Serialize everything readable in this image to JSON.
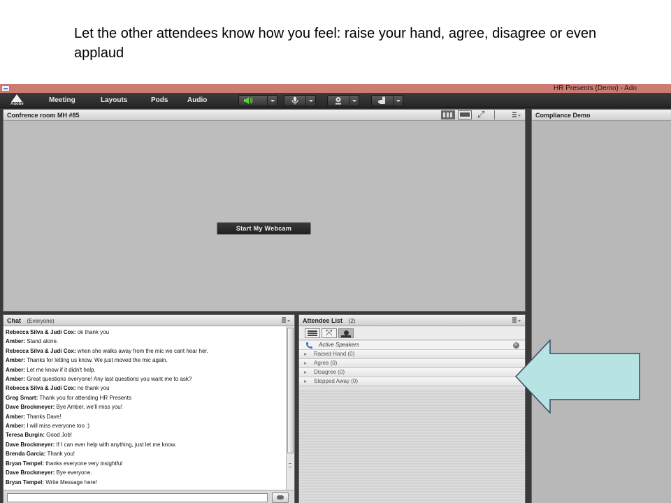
{
  "slide": {
    "caption": "Let the other attendees know how you feel: raise your hand, agree, disagree or even applaud"
  },
  "window": {
    "title": "HR Presents (Demo) - Ado"
  },
  "logo": {
    "text": "Adobe"
  },
  "menu": {
    "items": [
      "Meeting",
      "Layouts",
      "Pods",
      "Audio"
    ]
  },
  "toolbar": {
    "buttons": [
      {
        "icon": "speaker-icon",
        "active_color": "#5bd23a"
      },
      {
        "icon": "microphone-icon"
      },
      {
        "icon": "webcam-icon"
      },
      {
        "icon": "raise-hand-icon"
      }
    ]
  },
  "video_pod": {
    "title": "Confrence room MH #85",
    "webcam_button": "Start My Webcam"
  },
  "side_pod": {
    "title": "Compliance Demo"
  },
  "chat_pod": {
    "title": "Chat",
    "scope": "(Everyone)",
    "messages": [
      {
        "who": "Rebecca Silva & Judi Cox:",
        "text": " ok thank you"
      },
      {
        "who": "Amber:",
        "text": " Stand alone."
      },
      {
        "who": "Rebecca Silva & Judi Cox:",
        "text": " when she walks away from the mic we cant hear her."
      },
      {
        "who": "Amber:",
        "text": " Thanks for letting us know. We just moved the mic again."
      },
      {
        "who": "Amber:",
        "text": " Let me know if it didn't help."
      },
      {
        "who": "Amber:",
        "text": " Great questions everyone! Any last questions you want me to ask?"
      },
      {
        "who": "Rebecca Silva & Judi Cox:",
        "text": " no thank you"
      },
      {
        "who": "Greg Smart:",
        "text": " Thank you for attending HR Presents"
      },
      {
        "who": "Dave Brockmeyer:",
        "text": " Bye Amber, we'll miss you!"
      },
      {
        "who": "Amber:",
        "text": " Thanks Dave!"
      },
      {
        "who": "Amber:",
        "text": " I will miss everyone too :)"
      },
      {
        "who": "Teresa Burgin:",
        "text": " Good Job!"
      },
      {
        "who": "Dave Brockmeyer:",
        "text": " If I can ever help with anything, just let me know."
      },
      {
        "who": "Brenda Garcia:",
        "text": " Thank you!"
      },
      {
        "who": "Bryan Tempel:",
        "text": " thanks everyone very insightful"
      },
      {
        "who": "Dave Brockmeyer:",
        "text": " Bye everyone."
      },
      {
        "who": "Bryan Tempel:",
        "text": " Write Message here!"
      }
    ]
  },
  "attendee_pod": {
    "title": "Attendee List",
    "count": "(2)",
    "active_speakers": "Active Speakers",
    "statuses": [
      {
        "label": "Raised Hand (0)"
      },
      {
        "label": "Agree (0)"
      },
      {
        "label": "Disagree (0)"
      },
      {
        "label": "Stepped Away (0)"
      }
    ]
  },
  "callout": {
    "fill": "#b7e3e3",
    "stroke": "#3a4a6a"
  }
}
